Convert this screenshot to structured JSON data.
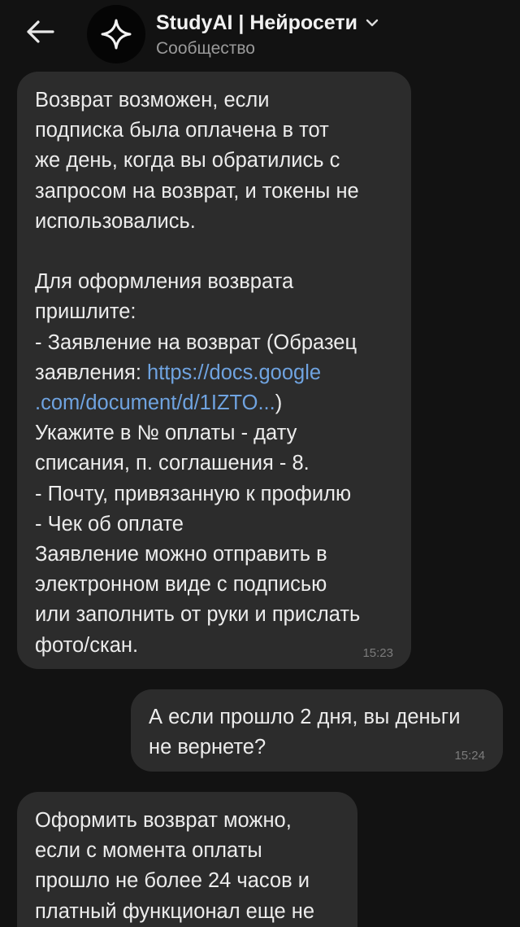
{
  "header": {
    "title": "StudyAI | Нейросети",
    "subtitle": "Сообщество",
    "icons": {
      "back": "arrow-left-icon",
      "avatar": "sparkle-star-icon",
      "dropdown": "chevron-down-icon"
    }
  },
  "messages": [
    {
      "id": "msg1",
      "direction": "incoming",
      "text_before_link": "Возврат возможен, если\nподписка была оплачена в тот\nже день, когда вы обратились с\nзапросом на возврат, и токены не\nиспользовались.\n\nДля оформления возврата\nпришлите:\n- Заявление на возврат (Образец\nзаявления: ",
      "link_text": "https://docs.google\n.com/document/d/1IZTO...",
      "text_after_link": ")\nУкажите в № оплаты - дату\nсписания, п. соглашения - 8.\n- Почту, привязанную к профилю\n- Чек об оплате\nЗаявление можно отправить в\nэлектронном виде с подписью\nили заполнить от руки и прислать\nфото/скан.",
      "time": "15:23"
    },
    {
      "id": "msg2",
      "direction": "outgoing",
      "text": "А если прошло 2 дня, вы деньги\nне вернете?",
      "time": "15:24"
    },
    {
      "id": "msg3",
      "direction": "incoming",
      "text": "Оформить возврат можно,\nесли с момента оплаты\nпрошло не более 24 часов и\nплатный функционал еще не"
    }
  ],
  "colors": {
    "background": "#121212",
    "bubble": "#2c2c2c",
    "text": "#ececec",
    "subtitle": "#9a9a9a",
    "link": "#6fa3e0",
    "timestamp": "#7c7c7c"
  }
}
